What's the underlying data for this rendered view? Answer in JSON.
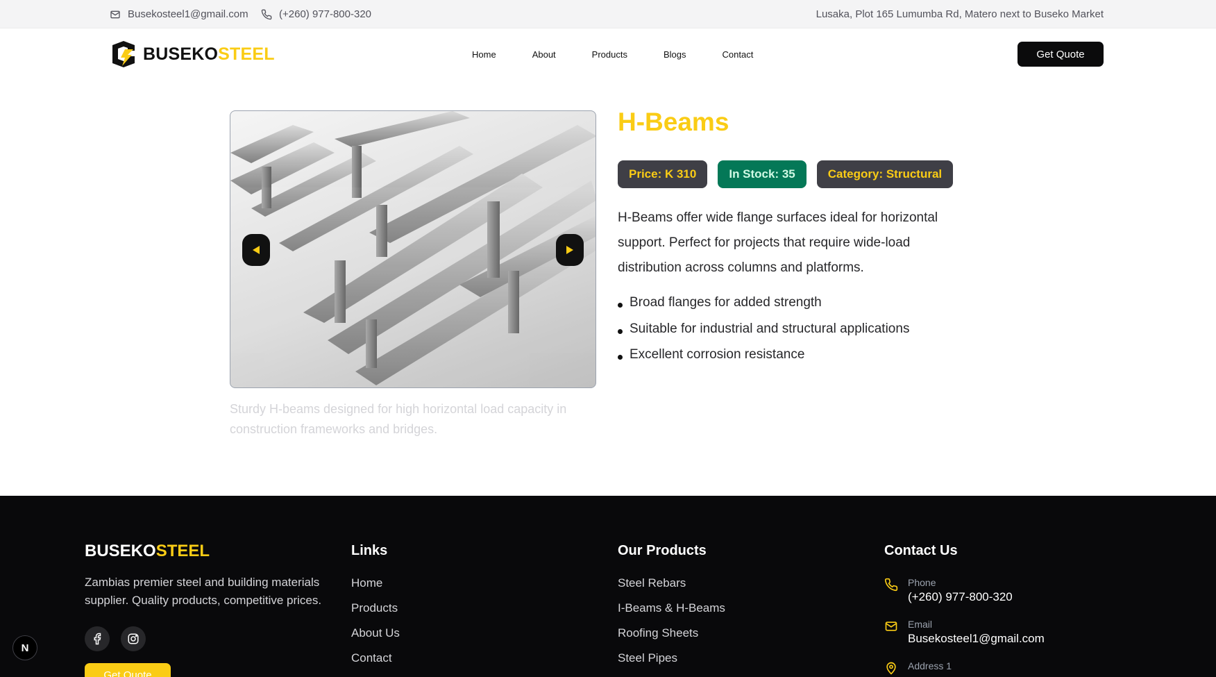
{
  "topbar": {
    "email": "Busekosteel1@gmail.com",
    "phone": "(+260) 977-800-320",
    "address": "Lusaka, Plot 165 Lumumba Rd, Matero next to Buseko Market"
  },
  "brand": {
    "part1": "BUSEKO",
    "part2": "STEEL"
  },
  "nav": {
    "home": "Home",
    "about": "About",
    "products": "Products",
    "blogs": "Blogs",
    "contact": "Contact"
  },
  "header": {
    "quote_label": "Get Quote"
  },
  "product": {
    "title": "H-Beams",
    "price": "Price: K 310",
    "stock": "In Stock: 35",
    "category": "Category: Structural",
    "description": "H-Beams offer wide flange surfaces ideal for horizontal support. Perfect for projects that require wide-load distribution across columns and platforms.",
    "features": [
      "Broad flanges for added strength",
      "Suitable for industrial and structural applications",
      "Excellent corrosion resistance"
    ],
    "caption": "Sturdy H-beams designed for high horizontal load capacity in construction frameworks and bridges."
  },
  "footer": {
    "brand_part1": "BUSEKO",
    "brand_part2": "STEEL",
    "about": "Zambias premier steel and building materials supplier. Quality products, competitive prices.",
    "quote_label": "Get Quote",
    "links_heading": "Links",
    "links": [
      "Home",
      "Products",
      "About Us",
      "Contact"
    ],
    "products_heading": "Our Products",
    "products": [
      "Steel Rebars",
      "I-Beams & H-Beams",
      "Roofing Sheets",
      "Steel Pipes"
    ],
    "contact_heading": "Contact Us",
    "phone_label": "Phone",
    "phone_value": "(+260) 977-800-320",
    "email_label": "Email",
    "email_value": "Busekosteel1@gmail.com",
    "address_label": "Address 1"
  },
  "colors": {
    "accent": "#facc15",
    "dark": "#09090b",
    "stock_green": "#047857"
  },
  "icons": [
    "mail-icon",
    "phone-icon",
    "logo-icon",
    "chevron-left-icon",
    "chevron-right-icon",
    "facebook-icon",
    "instagram-icon",
    "map-pin-icon"
  ]
}
